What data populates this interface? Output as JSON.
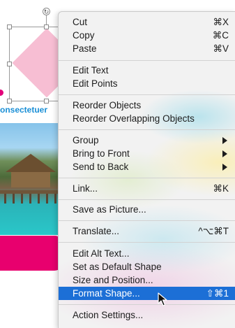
{
  "slide": {
    "text_fragment": "onsectetuer",
    "accent_pink": "#e8006e",
    "diamond_color": "#f7bed3",
    "text_color": "#1a8fd6"
  },
  "context_menu": {
    "highlight_color": "#1c6fd6",
    "items": [
      {
        "label": "Cut",
        "shortcut": "⌘X"
      },
      {
        "label": "Copy",
        "shortcut": "⌘C"
      },
      {
        "label": "Paste",
        "shortcut": "⌘V"
      },
      {
        "label": "Edit Text",
        "shortcut": ""
      },
      {
        "label": "Edit Points",
        "shortcut": ""
      },
      {
        "label": "Reorder Objects",
        "shortcut": ""
      },
      {
        "label": "Reorder Overlapping Objects",
        "shortcut": ""
      },
      {
        "label": "Group",
        "shortcut": "",
        "submenu": true
      },
      {
        "label": "Bring to Front",
        "shortcut": "",
        "submenu": true
      },
      {
        "label": "Send to Back",
        "shortcut": "",
        "submenu": true
      },
      {
        "label": "Link...",
        "shortcut": "⌘K"
      },
      {
        "label": "Save as Picture...",
        "shortcut": ""
      },
      {
        "label": "Translate...",
        "shortcut": "^⌥⌘T"
      },
      {
        "label": "Edit Alt Text...",
        "shortcut": ""
      },
      {
        "label": "Set as Default Shape",
        "shortcut": ""
      },
      {
        "label": "Size and Position...",
        "shortcut": ""
      },
      {
        "label": "Format Shape...",
        "shortcut": "⇧⌘1",
        "highlighted": true
      },
      {
        "label": "Action Settings...",
        "shortcut": ""
      }
    ]
  }
}
